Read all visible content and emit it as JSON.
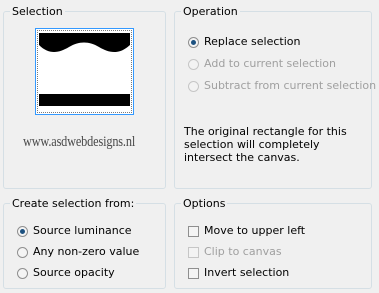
{
  "selection": {
    "title": "Selection",
    "watermark": "www.asdwebdesigns.nl"
  },
  "operation": {
    "title": "Operation",
    "options": [
      {
        "label": "Replace selection",
        "checked": true,
        "enabled": true
      },
      {
        "label": "Add to current selection",
        "checked": false,
        "enabled": false
      },
      {
        "label": "Subtract from current selection",
        "checked": false,
        "enabled": false
      }
    ],
    "description": "The original rectangle for this selection will completely intersect the canvas."
  },
  "create_from": {
    "title": "Create selection from:",
    "options": [
      {
        "label": "Source luminance",
        "checked": true
      },
      {
        "label": "Any non-zero value",
        "checked": false
      },
      {
        "label": "Source opacity",
        "checked": false
      }
    ]
  },
  "options": {
    "title": "Options",
    "items": [
      {
        "label": "Move to upper left",
        "checked": false,
        "enabled": true
      },
      {
        "label": "Clip to canvas",
        "checked": false,
        "enabled": false
      },
      {
        "label": "Invert selection",
        "checked": false,
        "enabled": true
      }
    ]
  },
  "colors": {
    "background": "#f0f0f0",
    "group_border": "#d5dfe5",
    "thumb_border": "#3399ff",
    "radio_dot": "#1c5180",
    "disabled_text": "#a0a0a0"
  }
}
